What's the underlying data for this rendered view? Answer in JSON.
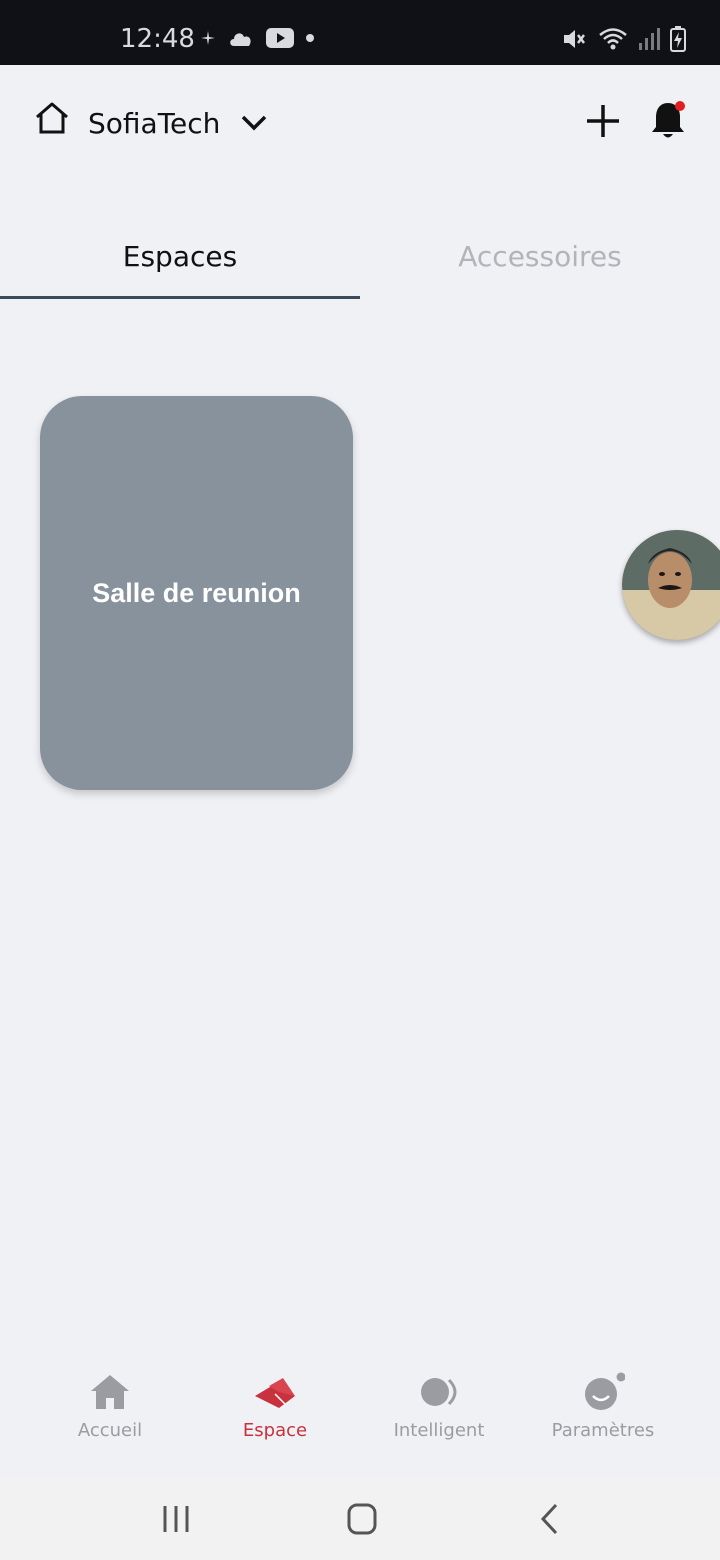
{
  "status_bar": {
    "time": "12:48",
    "left_icons": [
      "sparkle-icon",
      "cloud-icon",
      "youtube-icon",
      "dot-icon"
    ],
    "right_icons": [
      "mute-icon",
      "wifi-icon",
      "signal-icon",
      "battery-charging-icon"
    ]
  },
  "header": {
    "org_name": "SofiaTech",
    "icons": [
      "home-icon",
      "chevron-down-icon",
      "plus-icon",
      "bell-icon"
    ],
    "notification_dot_color": "#e02020"
  },
  "tabs": [
    {
      "label": "Espaces",
      "active": true
    },
    {
      "label": "Accessoires",
      "active": false
    }
  ],
  "spaces": [
    {
      "name": "Salle de reunion",
      "color": "#87929d"
    }
  ],
  "bottom_nav": [
    {
      "label": "Accueil",
      "icon": "house-icon",
      "active": false
    },
    {
      "label": "Espace",
      "icon": "space-icon",
      "active": true
    },
    {
      "label": "Intelligent",
      "icon": "smart-icon",
      "active": false
    },
    {
      "label": "Paramètres",
      "icon": "settings-face-icon",
      "active": false
    }
  ],
  "colors": {
    "accent": "#c8323f",
    "inactive": "#9b9ca1",
    "background": "#f0f1f5",
    "tab_underline": "#3d4a5c"
  }
}
